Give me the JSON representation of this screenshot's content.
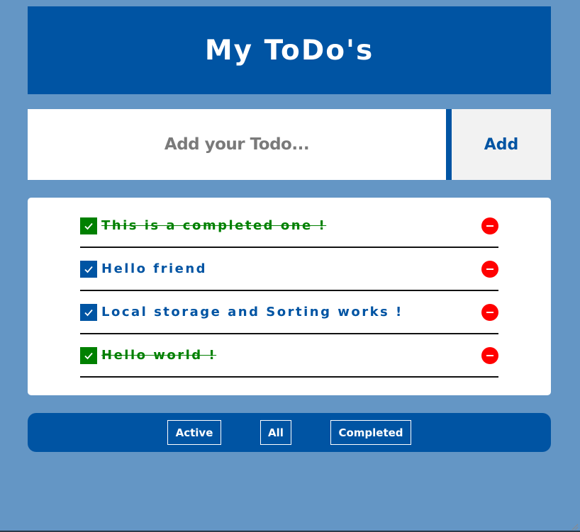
{
  "header": {
    "title": "My ToDo's"
  },
  "add_form": {
    "placeholder": "Add your Todo...",
    "value": "",
    "add_label": "Add"
  },
  "todos": [
    {
      "text": "This is a completed one !",
      "completed": true
    },
    {
      "text": "Hello friend",
      "completed": false
    },
    {
      "text": "Local storage and Sorting works !",
      "completed": false
    },
    {
      "text": "Hello world !",
      "completed": true
    }
  ],
  "filters": {
    "active_label": "Active",
    "all_label": "All",
    "completed_label": "Completed"
  },
  "colors": {
    "background": "#6496c5",
    "primary": "#0054a3",
    "completed": "#008000",
    "remove": "#ff0000"
  },
  "icons": {
    "check": "check-icon",
    "remove": "minus-circle-icon"
  }
}
